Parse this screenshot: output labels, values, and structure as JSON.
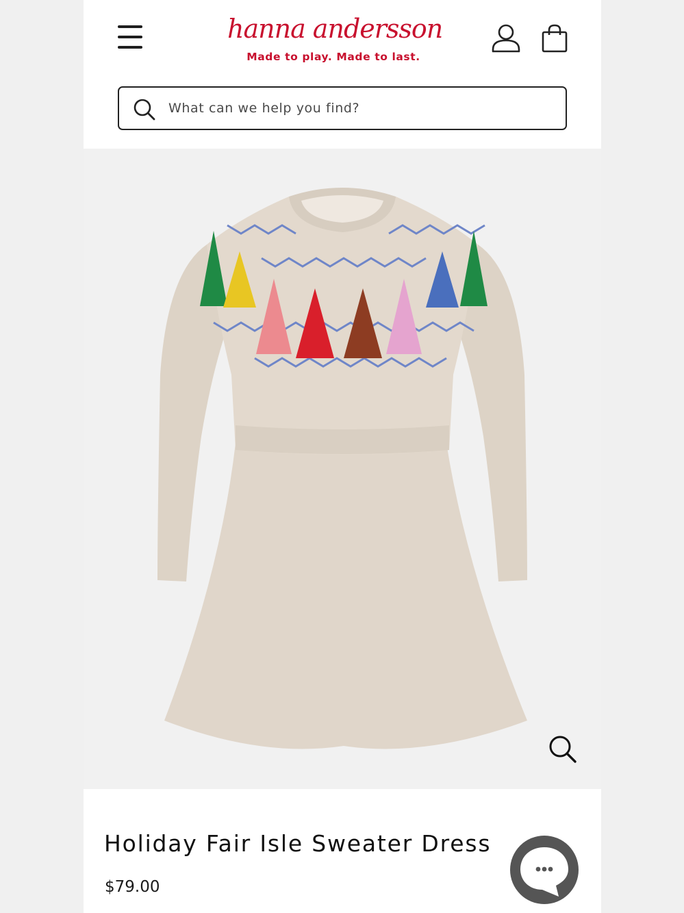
{
  "header": {
    "menu_icon": "hamburger-menu-icon",
    "logo_text": "hanna andersson",
    "tagline": "Made to play. Made to last.",
    "account_icon": "user-icon",
    "bag_icon": "shopping-bag-icon"
  },
  "search": {
    "icon": "search-icon",
    "placeholder": "What can we help you find?"
  },
  "product": {
    "zoom_icon": "zoom-icon",
    "title": "Holiday Fair Isle Sweater Dress",
    "price": "$79.00"
  },
  "chat": {
    "icon": "chat-bubble-icon"
  },
  "colors": {
    "brand_red": "#c8102e",
    "text_dark": "#111111",
    "dress_oatmeal": "#e2d8cc"
  }
}
